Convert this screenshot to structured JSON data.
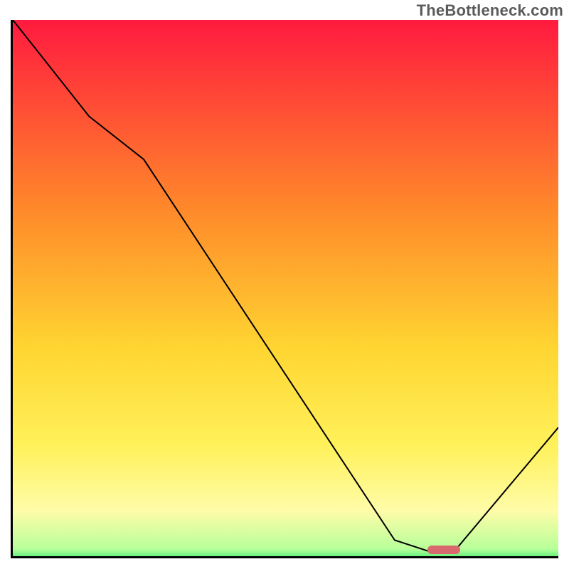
{
  "watermark": "TheBottleneck.com",
  "chart_data": {
    "type": "line",
    "title": "",
    "xlabel": "",
    "ylabel": "",
    "xlim": [
      0,
      100
    ],
    "ylim": [
      0,
      100
    ],
    "grid": false,
    "legend": false,
    "background_gradient": {
      "stops": [
        {
          "offset": 0.0,
          "color": "#ff1a3f"
        },
        {
          "offset": 0.35,
          "color": "#ff8a2a"
        },
        {
          "offset": 0.6,
          "color": "#ffd531"
        },
        {
          "offset": 0.78,
          "color": "#fff15a"
        },
        {
          "offset": 0.9,
          "color": "#fffca8"
        },
        {
          "offset": 0.97,
          "color": "#b7ff9a"
        },
        {
          "offset": 1.0,
          "color": "#00e05a"
        }
      ]
    },
    "series": [
      {
        "name": "bottleneck-curve",
        "x": [
          0,
          14,
          24,
          70,
          76,
          81,
          100
        ],
        "y": [
          100,
          82,
          74,
          3,
          1,
          1,
          24
        ]
      }
    ],
    "optimal_marker": {
      "x_start": 76,
      "x_end": 82,
      "y": 1.2
    }
  }
}
